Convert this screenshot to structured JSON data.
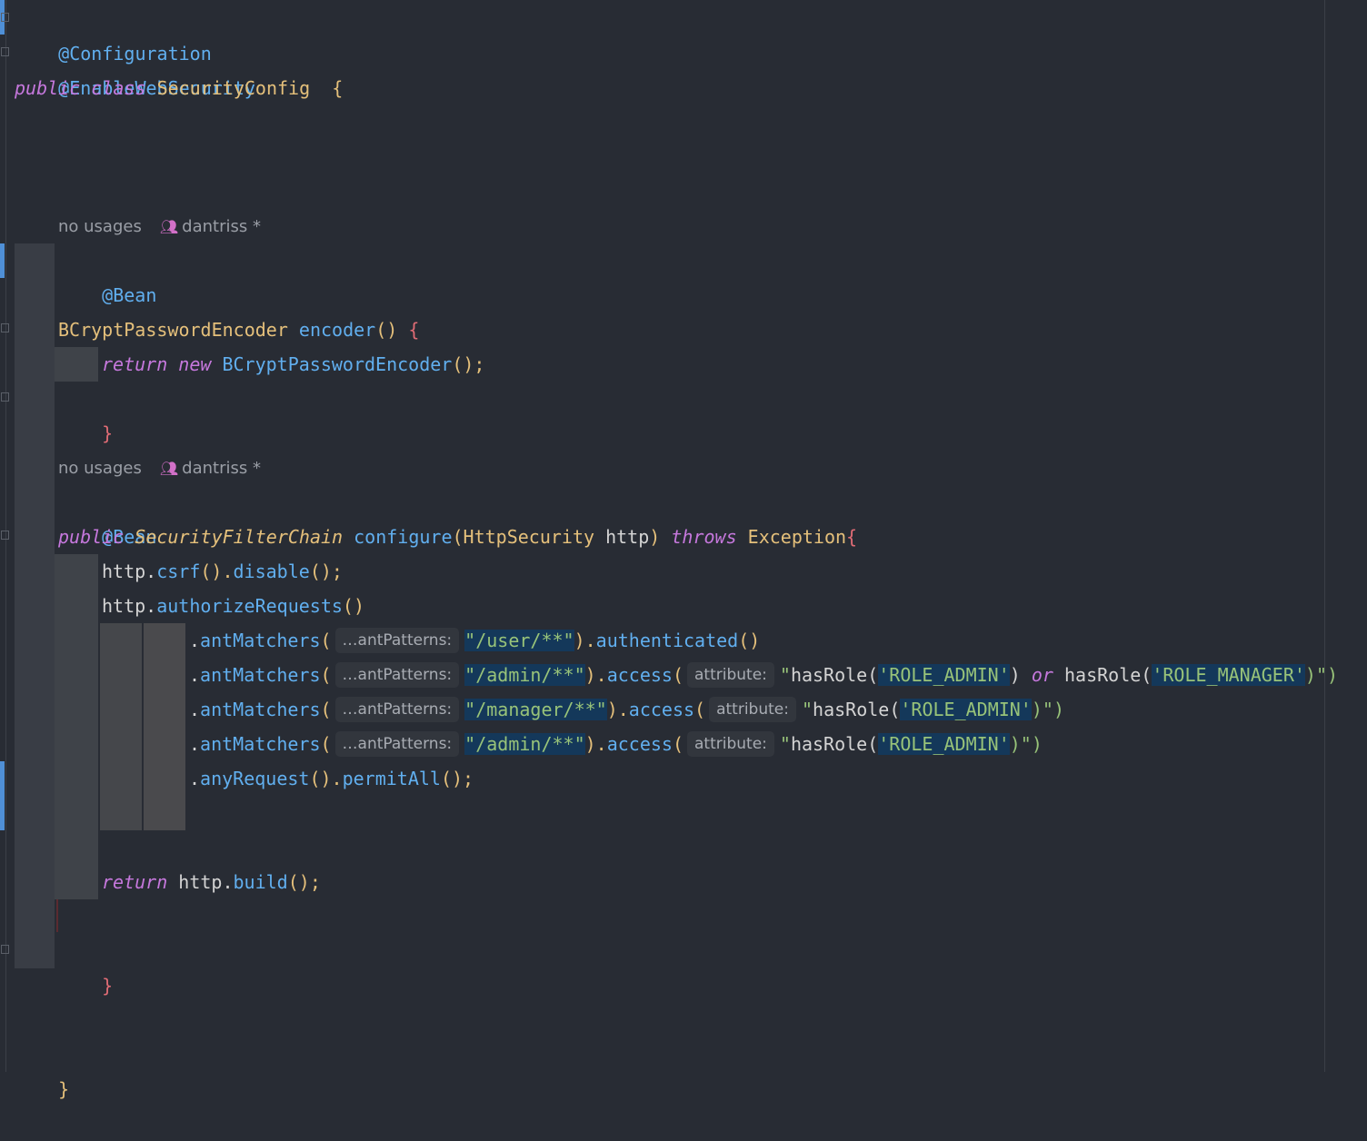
{
  "code": {
    "l1_annotation": "@Configuration",
    "l2_annotation": "@EnableWebSecurity",
    "l3_public": "public",
    "l3_class": "class",
    "l3_name": "SecurityConfig",
    "l3_brace": "{",
    "meta1_usages": "no usages",
    "meta1_author": "dantriss *",
    "bean1": "@Bean",
    "enc_type": "BCryptPasswordEncoder",
    "enc_method": "encoder",
    "enc_parens": "()",
    "enc_brace": "{",
    "ret1_return": "return",
    "ret1_new": "new",
    "ret1_class": "BCryptPasswordEncoder",
    "ret1_tail": "();",
    "close1": "}",
    "meta2_usages": "no usages",
    "meta2_author": "dantriss *",
    "bean2": "@Bean",
    "cfg_public": "public",
    "cfg_type": "SecurityFilterChain",
    "cfg_method": "configure",
    "cfg_param_type": "HttpSecurity",
    "cfg_param_name": "http",
    "cfg_throws": "throws",
    "cfg_exception": "Exception",
    "cfg_brace": "{",
    "csrf_http": "http.",
    "csrf_call": "csrf",
    "csrf_mid": "().",
    "csrf_disable": "disable",
    "csrf_tail": "();",
    "auth_http": "http.",
    "auth_call": "authorizeRequests",
    "auth_tail": "()",
    "am_dot": ".",
    "am_fn": "antMatchers",
    "am_open": "(",
    "hint_patterns": "…antPatterns:",
    "hint_attribute": "attribute:",
    "m1_pattern": "\"/user/**\"",
    "m1_close": ").",
    "m1_fn": "authenticated",
    "m1_tail": "()",
    "m2_pattern": "\"/admin/**\"",
    "m2_close": ").",
    "m2_fn": "access",
    "m2_open": "(",
    "m2_q": "\"",
    "m2_has1": "hasRole(",
    "m2_role1": "'ROLE_ADMIN'",
    "m2_close1": ")",
    "m2_or": "or",
    "m2_has2": "hasRole(",
    "m2_role2": "'ROLE_MANAGER'",
    "m2_end": ")\")",
    "m3_pattern": "\"/manager/**\"",
    "m3_close": ").",
    "m3_fn": "access",
    "m3_open": "(",
    "m3_q": "\"",
    "m3_has": "hasRole(",
    "m3_role": "'ROLE_ADMIN'",
    "m3_end": ")\")",
    "m4_pattern": "\"/admin/**\"",
    "m4_close": ").",
    "m4_fn": "access",
    "m4_open": "(",
    "m4_q": "\"",
    "m4_has": "hasRole(",
    "m4_role": "'ROLE_ADMIN'",
    "m4_end": ")\")",
    "any_dot": ".",
    "any_fn": "anyRequest",
    "any_mid": "().",
    "any_permit": "permitAll",
    "any_tail": "();",
    "ret2_return": "return",
    "ret2_http": "http.",
    "ret2_build": "build",
    "ret2_tail": "();",
    "close2": "}",
    "close_class": "}"
  },
  "colors": {
    "background": "#282c34",
    "keyword": "#c678dd",
    "annotation": "#61afef",
    "class": "#e5c07b",
    "string": "#98c379",
    "highlight": "#14385a"
  },
  "icons": {
    "author": "users-icon"
  }
}
